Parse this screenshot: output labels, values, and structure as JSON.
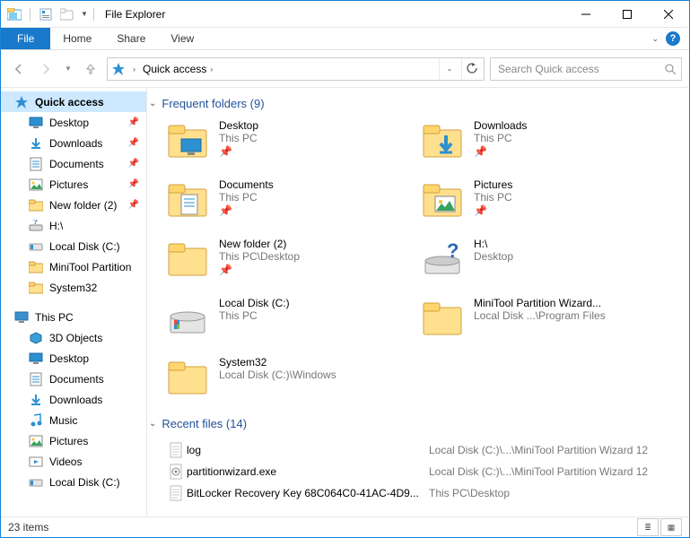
{
  "window": {
    "title": "File Explorer"
  },
  "ribbon": {
    "file": "File",
    "tabs": [
      "Home",
      "Share",
      "View"
    ]
  },
  "address": {
    "location": "Quick access",
    "search_placeholder": "Search Quick access"
  },
  "tree": {
    "quick_access": "Quick access",
    "items": [
      {
        "label": "Desktop",
        "pinned": true,
        "icon": "desktop"
      },
      {
        "label": "Downloads",
        "pinned": true,
        "icon": "downloads"
      },
      {
        "label": "Documents",
        "pinned": true,
        "icon": "documents"
      },
      {
        "label": "Pictures",
        "pinned": true,
        "icon": "pictures"
      },
      {
        "label": "New folder (2)",
        "pinned": true,
        "icon": "folder"
      },
      {
        "label": "H:\\",
        "pinned": false,
        "icon": "netdrive"
      },
      {
        "label": "Local Disk (C:)",
        "pinned": false,
        "icon": "drive"
      },
      {
        "label": "MiniTool Partition",
        "pinned": false,
        "icon": "folder"
      },
      {
        "label": "System32",
        "pinned": false,
        "icon": "folder"
      }
    ],
    "this_pc": "This PC",
    "pc_items": [
      {
        "label": "3D Objects",
        "icon": "3d"
      },
      {
        "label": "Desktop",
        "icon": "desktop"
      },
      {
        "label": "Documents",
        "icon": "documents"
      },
      {
        "label": "Downloads",
        "icon": "downloads"
      },
      {
        "label": "Music",
        "icon": "music"
      },
      {
        "label": "Pictures",
        "icon": "pictures"
      },
      {
        "label": "Videos",
        "icon": "videos"
      },
      {
        "label": "Local Disk (C:)",
        "icon": "drive"
      }
    ]
  },
  "groups": {
    "frequent": {
      "label": "Frequent folders",
      "count": 9
    },
    "recent": {
      "label": "Recent files",
      "count": 14
    }
  },
  "folders": [
    {
      "name": "Desktop",
      "sub": "This PC",
      "pinned": true,
      "icon": "desktop-big"
    },
    {
      "name": "Downloads",
      "sub": "This PC",
      "pinned": true,
      "icon": "downloads-big"
    },
    {
      "name": "Documents",
      "sub": "This PC",
      "pinned": true,
      "icon": "documents-big"
    },
    {
      "name": "Pictures",
      "sub": "This PC",
      "pinned": true,
      "icon": "pictures-big"
    },
    {
      "name": "New folder (2)",
      "sub": "This PC\\Desktop",
      "pinned": true,
      "icon": "folder-big"
    },
    {
      "name": "H:\\",
      "sub": "Desktop",
      "pinned": false,
      "icon": "netdrive-big"
    },
    {
      "name": "Local Disk (C:)",
      "sub": "This PC",
      "pinned": false,
      "icon": "drive-big"
    },
    {
      "name": "MiniTool Partition Wizard...",
      "sub": "Local Disk ...\\Program Files",
      "pinned": false,
      "icon": "folder-big"
    },
    {
      "name": "System32",
      "sub": "Local Disk (C:)\\Windows",
      "pinned": false,
      "icon": "folder-big"
    }
  ],
  "recent": [
    {
      "name": "log",
      "path": "Local Disk (C:)\\...\\MiniTool Partition Wizard 12",
      "icon": "txt"
    },
    {
      "name": "partitionwizard.exe",
      "path": "Local Disk (C:)\\...\\MiniTool Partition Wizard 12",
      "icon": "exe"
    },
    {
      "name": "BitLocker Recovery Key 68C064C0-41AC-4D9...",
      "path": "This PC\\Desktop",
      "icon": "txt"
    }
  ],
  "status": {
    "items": "23 items"
  }
}
